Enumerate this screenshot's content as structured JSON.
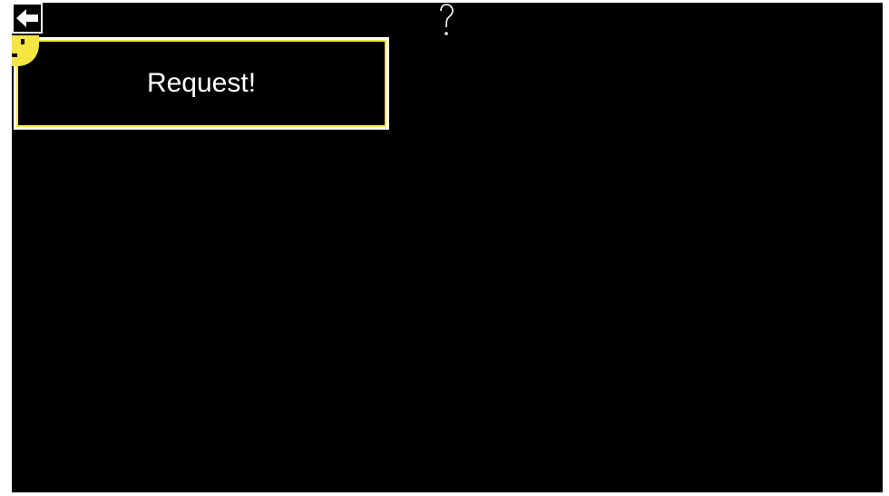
{
  "screen": {
    "background_color": "#000000"
  },
  "toolbar": {
    "back_icon": "left-arrow-icon",
    "help_icon": "question-mark-icon"
  },
  "request": {
    "label": "Request!",
    "border_color": "#f5e642",
    "badge_icon": "smiley-icon"
  }
}
